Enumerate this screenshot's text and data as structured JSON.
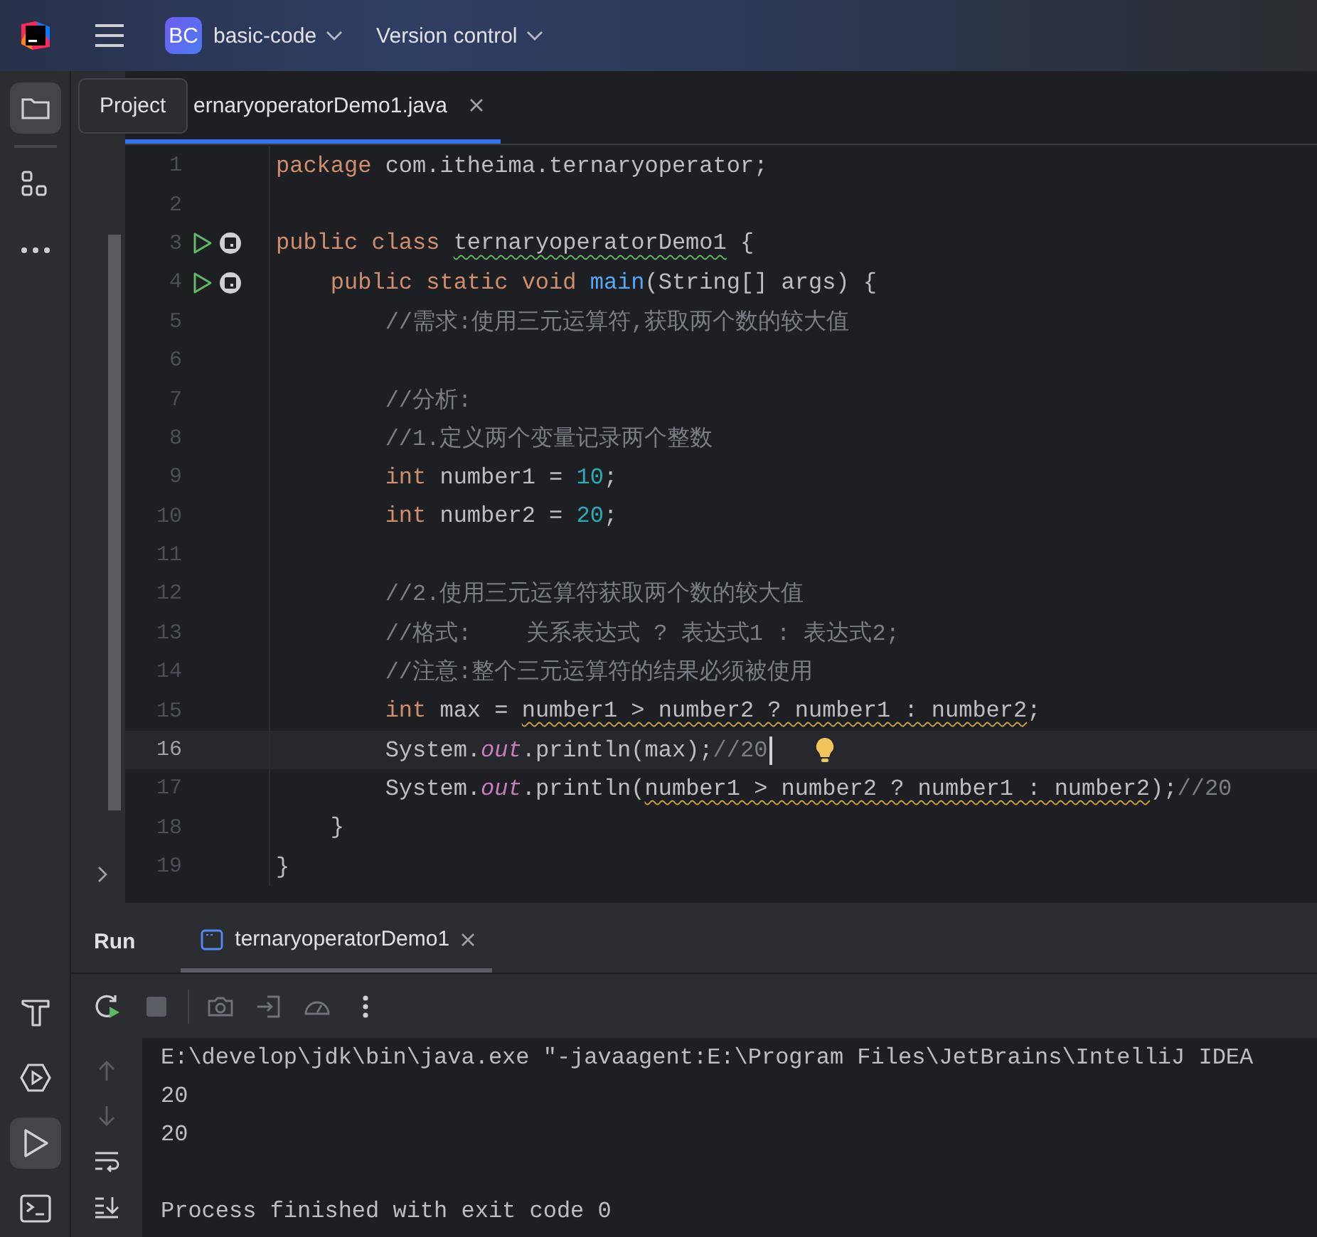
{
  "top_bar": {
    "project_badge": "BC",
    "project": "basic-code",
    "vcs": "Version control"
  },
  "left_strip": {
    "top_items": [
      {
        "kind": "project",
        "selected": true
      },
      {
        "kind": "structure",
        "selected": false
      },
      {
        "kind": "more",
        "selected": false
      }
    ],
    "bottom_items": [
      {
        "kind": "build",
        "selected": false
      },
      {
        "kind": "services",
        "selected": false
      },
      {
        "kind": "run",
        "selected": true
      },
      {
        "kind": "terminal",
        "selected": false
      }
    ]
  },
  "tooltip": "Project",
  "editor_tabs": [
    {
      "label": "ernaryoperatorDemo1.java",
      "selected": true
    }
  ],
  "code_lines": [
    {
      "number": "1",
      "current": false,
      "run_marker": false,
      "tokens": [
        {
          "text": "package",
          "kind": "keyword"
        },
        {
          "text": " com.itheima.ternaryoperator;",
          "kind": "plain"
        }
      ]
    },
    {
      "number": "2",
      "current": false,
      "run_marker": false
    },
    {
      "number": "3",
      "current": false,
      "run_marker": true,
      "tokens": [
        {
          "text": "public class ",
          "kind": "keyword"
        },
        {
          "text": "ternaryoperatorDemo1",
          "kind": "typo"
        },
        {
          "text": " {",
          "kind": "plain"
        }
      ]
    },
    {
      "number": "4",
      "current": false,
      "run_marker": true,
      "tokens": [
        {
          "text": "    public static void ",
          "kind": "keyword"
        },
        {
          "text": "main",
          "kind": "method"
        },
        {
          "text": "(String[] args) {",
          "kind": "plain"
        }
      ]
    },
    {
      "number": "5",
      "current": false,
      "run_marker": false,
      "tokens": [
        {
          "text": "        //需求:使用三元运算符,获取两个数的较大值",
          "kind": "comment"
        }
      ]
    },
    {
      "number": "6",
      "current": false,
      "run_marker": false
    },
    {
      "number": "7",
      "current": false,
      "run_marker": false,
      "tokens": [
        {
          "text": "        //分析:",
          "kind": "comment"
        }
      ]
    },
    {
      "number": "8",
      "current": false,
      "run_marker": false,
      "tokens": [
        {
          "text": "        //1.定义两个变量记录两个整数",
          "kind": "comment"
        }
      ]
    },
    {
      "number": "9",
      "current": false,
      "run_marker": false,
      "tokens": [
        {
          "text": "        int",
          "kind": "keyword"
        },
        {
          "text": " number1 = ",
          "kind": "plain"
        },
        {
          "text": "10",
          "kind": "number"
        },
        {
          "text": ";",
          "kind": "plain"
        }
      ]
    },
    {
      "number": "10",
      "current": false,
      "run_marker": false,
      "tokens": [
        {
          "text": "        int",
          "kind": "keyword"
        },
        {
          "text": " number2 = ",
          "kind": "plain"
        },
        {
          "text": "20",
          "kind": "number"
        },
        {
          "text": ";",
          "kind": "plain"
        }
      ]
    },
    {
      "number": "11",
      "current": false,
      "run_marker": false
    },
    {
      "number": "12",
      "current": false,
      "run_marker": false,
      "tokens": [
        {
          "text": "        //2.使用三元运算符获取两个数的较大值",
          "kind": "comment"
        }
      ]
    },
    {
      "number": "13",
      "current": false,
      "run_marker": false,
      "tokens": [
        {
          "text": "        //格式:    关系表达式 ? 表达式1 : 表达式2;",
          "kind": "comment"
        }
      ]
    },
    {
      "number": "14",
      "current": false,
      "run_marker": false,
      "tokens": [
        {
          "text": "        //注意:整个三元运算符的结果必须被使用",
          "kind": "comment"
        }
      ]
    },
    {
      "number": "15",
      "current": false,
      "run_marker": false,
      "tokens": [
        {
          "text": "        int",
          "kind": "keyword"
        },
        {
          "text": " max = ",
          "kind": "plain"
        },
        {
          "text": "number1 > number2 ? number1 : number2",
          "kind": "warning"
        },
        {
          "text": ";",
          "kind": "plain"
        }
      ]
    },
    {
      "number": "16",
      "current": true,
      "run_marker": false,
      "tokens": [
        {
          "text": "        System.",
          "kind": "plain"
        },
        {
          "text": "out",
          "kind": "field"
        },
        {
          "text": ".println(max);",
          "kind": "plain"
        },
        {
          "text": "//20",
          "kind": "comment"
        }
      ]
    },
    {
      "number": "17",
      "current": false,
      "run_marker": false,
      "tokens": [
        {
          "text": "        System.",
          "kind": "plain"
        },
        {
          "text": "out",
          "kind": "field"
        },
        {
          "text": ".println(",
          "kind": "plain"
        },
        {
          "text": "number1 > number2 ? number1 : number2",
          "kind": "warning"
        },
        {
          "text": ");",
          "kind": "plain"
        },
        {
          "text": "//20",
          "kind": "comment"
        }
      ]
    },
    {
      "number": "18",
      "current": false,
      "run_marker": false,
      "tokens": [
        {
          "text": "    }",
          "kind": "plain"
        }
      ]
    },
    {
      "number": "19",
      "current": false,
      "run_marker": false,
      "tokens": [
        {
          "text": "}",
          "kind": "plain"
        }
      ]
    }
  ],
  "run_panel": {
    "title": "Run",
    "tabs": [
      {
        "label": "ternaryoperatorDemo1",
        "selected": true
      }
    ],
    "console": [
      {
        "kind": "command",
        "text": "E:\\develop\\jdk\\bin\\java.exe \"-javaagent:E:\\Program Files\\JetBrains\\IntelliJ IDEA"
      },
      {
        "kind": "output",
        "text": "20"
      },
      {
        "kind": "output",
        "text": "20"
      },
      {
        "kind": "exit",
        "text": "Process finished with exit code 0"
      }
    ]
  }
}
